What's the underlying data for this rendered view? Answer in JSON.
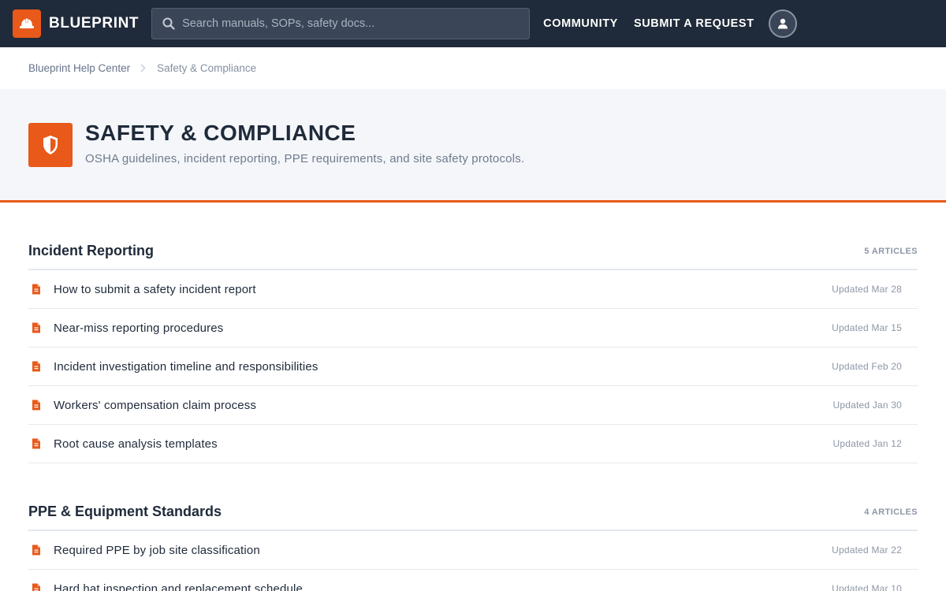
{
  "header": {
    "brand": "BLUEPRINT",
    "search_placeholder": "Search manuals, SOPs, safety docs...",
    "nav": {
      "community": "COMMUNITY",
      "submit_request": "SUBMIT A REQUEST"
    }
  },
  "breadcrumb": {
    "home": "Blueprint Help Center",
    "current": "Safety & Compliance"
  },
  "hero": {
    "title": "SAFETY & COMPLIANCE",
    "description": "OSHA guidelines, incident reporting, PPE requirements, and site safety protocols."
  },
  "sections": [
    {
      "title": "Incident Reporting",
      "count": "5 ARTICLES",
      "articles": [
        {
          "title": "How to submit a safety incident report",
          "updated": "Updated Mar 28"
        },
        {
          "title": "Near-miss reporting procedures",
          "updated": "Updated Mar 15"
        },
        {
          "title": "Incident investigation timeline and responsibilities",
          "updated": "Updated Feb 20"
        },
        {
          "title": "Workers' compensation claim process",
          "updated": "Updated Jan 30"
        },
        {
          "title": "Root cause analysis templates",
          "updated": "Updated Jan 12"
        }
      ]
    },
    {
      "title": "PPE & Equipment Standards",
      "count": "4 ARTICLES",
      "articles": [
        {
          "title": "Required PPE by job site classification",
          "updated": "Updated Mar 22"
        },
        {
          "title": "Hard hat inspection and replacement schedule",
          "updated": "Updated Mar 10"
        }
      ]
    }
  ],
  "icons": {
    "logo": "hard-hat-icon",
    "search": "search-icon",
    "avatar": "user-icon",
    "breadcrumb_separator": "chevron-right-icon",
    "hero": "shield-icon",
    "article": "document-icon"
  },
  "colors": {
    "accent": "#e8591a",
    "header_bg": "#1f2a3a",
    "hero_bg": "#f4f6f9"
  }
}
